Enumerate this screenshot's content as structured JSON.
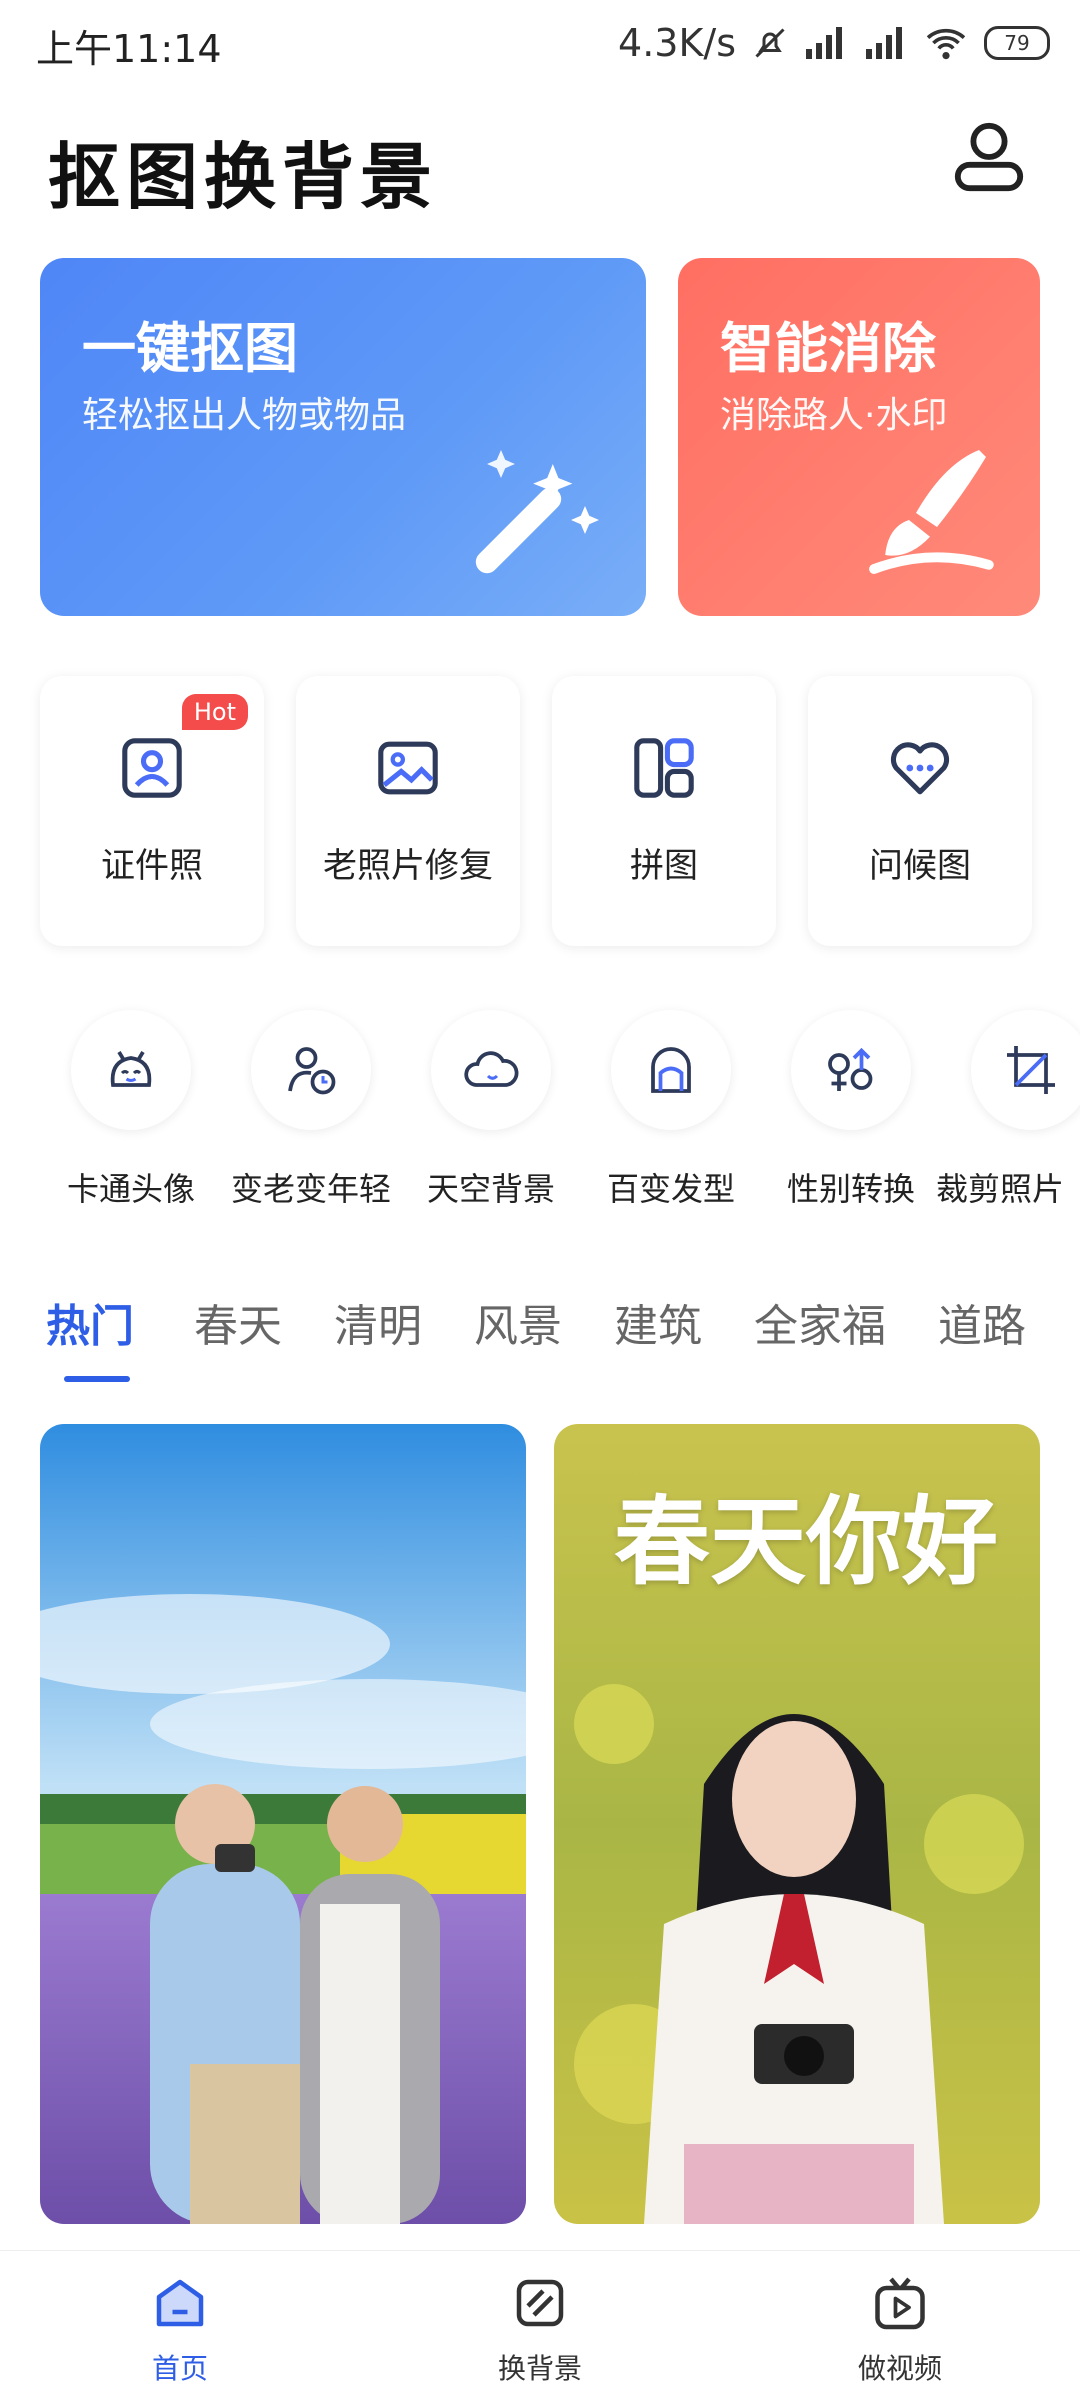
{
  "status_bar": {
    "time": "上午11:14",
    "net_speed": "4.3K/s",
    "battery": "79"
  },
  "header": {
    "title": "抠图换背景"
  },
  "hero_cards": [
    {
      "title": "一键抠图",
      "subtitle": "轻松抠出人物或物品",
      "icon": "magic-wand-icon"
    },
    {
      "title": "智能消除",
      "subtitle": "消除路人·水印",
      "icon": "brush-icon"
    }
  ],
  "features": [
    {
      "label": "证件照",
      "icon": "id-photo-icon",
      "badge": "Hot"
    },
    {
      "label": "老照片修复",
      "icon": "image-icon"
    },
    {
      "label": "拼图",
      "icon": "collage-icon"
    },
    {
      "label": "问候图",
      "icon": "heart-chat-icon"
    }
  ],
  "tools": [
    {
      "label": "卡通头像",
      "icon": "cartoon-face-icon"
    },
    {
      "label": "变老变年轻",
      "icon": "person-clock-icon"
    },
    {
      "label": "天空背景",
      "icon": "cloud-icon"
    },
    {
      "label": "百变发型",
      "icon": "hairstyle-icon"
    },
    {
      "label": "性别转换",
      "icon": "gender-icon"
    },
    {
      "label": "裁剪照片",
      "icon": "crop-icon"
    }
  ],
  "tabs": [
    {
      "label": "热门",
      "active": true
    },
    {
      "label": "春天"
    },
    {
      "label": "清明"
    },
    {
      "label": "风景"
    },
    {
      "label": "建筑"
    },
    {
      "label": "全家福"
    },
    {
      "label": "道路"
    }
  ],
  "gallery": {
    "right_card_text": "春天你好"
  },
  "bottom_nav": [
    {
      "label": "首页",
      "icon": "home-icon",
      "active": true
    },
    {
      "label": "换背景",
      "icon": "swap-background-icon"
    },
    {
      "label": "做视频",
      "icon": "tv-play-icon"
    }
  ],
  "colors": {
    "accent": "#2e5ee6",
    "hero_blue": "#4f86f7",
    "hero_red": "#ff6f62",
    "hot_badge": "#f44b4b"
  }
}
